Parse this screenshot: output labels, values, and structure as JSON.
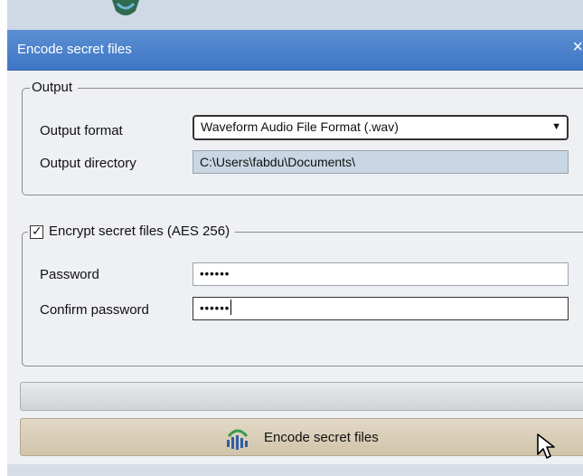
{
  "window": {
    "title": "Encode secret files",
    "close_glyph": "×"
  },
  "output_group": {
    "legend": "Output",
    "format_label": "Output format",
    "format_value": "Waveform Audio File Format (.wav)",
    "directory_label": "Output directory",
    "directory_value": "C:\\Users\\fabdu\\Documents\\"
  },
  "encrypt_group": {
    "checkbox_label": "Encrypt secret files (AES 256)",
    "checked": true,
    "check_glyph": "✓",
    "password_label": "Password",
    "password_value": "••••••",
    "confirm_label": "Confirm password",
    "confirm_value": "••••••"
  },
  "encode_button": {
    "label": "Encode secret files",
    "icon": "encode-wave-icon"
  },
  "colors": {
    "titlebar": "#4a80cb",
    "button": "#d8cdb6",
    "readonly_field": "#c9d6e3"
  }
}
